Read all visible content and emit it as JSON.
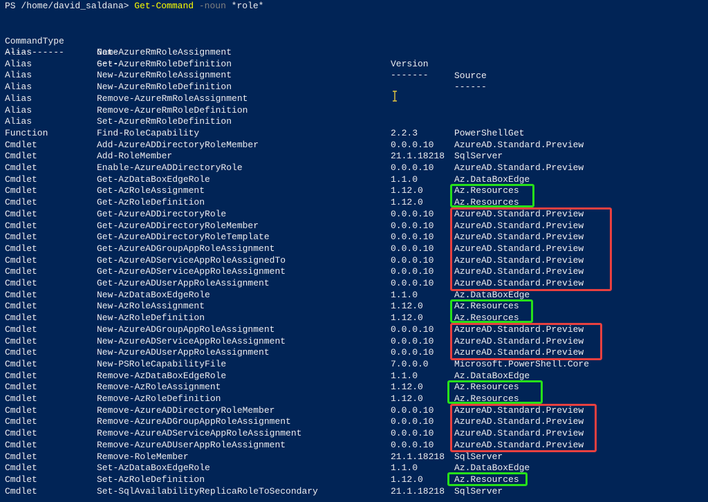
{
  "prompt": {
    "path": "PS /home/david_saldana> ",
    "command": "Get-Command",
    "param": " -noun ",
    "arg": "*role*"
  },
  "headers": {
    "type": "CommandType",
    "name": "Name",
    "version": "Version",
    "source": "Source",
    "type_rule": "-----------",
    "name_rule": "----",
    "version_rule": "-------",
    "source_rule": "------"
  },
  "rows": [
    {
      "type": "Alias",
      "name": "Get-AzureRmRoleAssignment",
      "version": "",
      "source": ""
    },
    {
      "type": "Alias",
      "name": "Get-AzureRmRoleDefinition",
      "version": "",
      "source": ""
    },
    {
      "type": "Alias",
      "name": "New-AzureRmRoleAssignment",
      "version": "",
      "source": ""
    },
    {
      "type": "Alias",
      "name": "New-AzureRmRoleDefinition",
      "version": "",
      "source": ""
    },
    {
      "type": "Alias",
      "name": "Remove-AzureRmRoleAssignment",
      "version": "",
      "source": ""
    },
    {
      "type": "Alias",
      "name": "Remove-AzureRmRoleDefinition",
      "version": "",
      "source": ""
    },
    {
      "type": "Alias",
      "name": "Set-AzureRmRoleDefinition",
      "version": "",
      "source": ""
    },
    {
      "type": "Function",
      "name": "Find-RoleCapability",
      "version": "2.2.3",
      "source": "PowerShellGet"
    },
    {
      "type": "Cmdlet",
      "name": "Add-AzureADDirectoryRoleMember",
      "version": "0.0.0.10",
      "source": "AzureAD.Standard.Preview"
    },
    {
      "type": "Cmdlet",
      "name": "Add-RoleMember",
      "version": "21.1.18218",
      "source": "SqlServer"
    },
    {
      "type": "Cmdlet",
      "name": "Enable-AzureADDirectoryRole",
      "version": "0.0.0.10",
      "source": "AzureAD.Standard.Preview"
    },
    {
      "type": "Cmdlet",
      "name": "Get-AzDataBoxEdgeRole",
      "version": "1.1.0",
      "source": "Az.DataBoxEdge"
    },
    {
      "type": "Cmdlet",
      "name": "Get-AzRoleAssignment",
      "version": "1.12.0",
      "source": "Az.Resources"
    },
    {
      "type": "Cmdlet",
      "name": "Get-AzRoleDefinition",
      "version": "1.12.0",
      "source": "Az.Resources"
    },
    {
      "type": "Cmdlet",
      "name": "Get-AzureADDirectoryRole",
      "version": "0.0.0.10",
      "source": "AzureAD.Standard.Preview"
    },
    {
      "type": "Cmdlet",
      "name": "Get-AzureADDirectoryRoleMember",
      "version": "0.0.0.10",
      "source": "AzureAD.Standard.Preview"
    },
    {
      "type": "Cmdlet",
      "name": "Get-AzureADDirectoryRoleTemplate",
      "version": "0.0.0.10",
      "source": "AzureAD.Standard.Preview"
    },
    {
      "type": "Cmdlet",
      "name": "Get-AzureADGroupAppRoleAssignment",
      "version": "0.0.0.10",
      "source": "AzureAD.Standard.Preview"
    },
    {
      "type": "Cmdlet",
      "name": "Get-AzureADServiceAppRoleAssignedTo",
      "version": "0.0.0.10",
      "source": "AzureAD.Standard.Preview"
    },
    {
      "type": "Cmdlet",
      "name": "Get-AzureADServiceAppRoleAssignment",
      "version": "0.0.0.10",
      "source": "AzureAD.Standard.Preview"
    },
    {
      "type": "Cmdlet",
      "name": "Get-AzureADUserAppRoleAssignment",
      "version": "0.0.0.10",
      "source": "AzureAD.Standard.Preview"
    },
    {
      "type": "Cmdlet",
      "name": "New-AzDataBoxEdgeRole",
      "version": "1.1.0",
      "source": "Az.DataBoxEdge"
    },
    {
      "type": "Cmdlet",
      "name": "New-AzRoleAssignment",
      "version": "1.12.0",
      "source": "Az.Resources"
    },
    {
      "type": "Cmdlet",
      "name": "New-AzRoleDefinition",
      "version": "1.12.0",
      "source": "Az.Resources"
    },
    {
      "type": "Cmdlet",
      "name": "New-AzureADGroupAppRoleAssignment",
      "version": "0.0.0.10",
      "source": "AzureAD.Standard.Preview"
    },
    {
      "type": "Cmdlet",
      "name": "New-AzureADServiceAppRoleAssignment",
      "version": "0.0.0.10",
      "source": "AzureAD.Standard.Preview"
    },
    {
      "type": "Cmdlet",
      "name": "New-AzureADUserAppRoleAssignment",
      "version": "0.0.0.10",
      "source": "AzureAD.Standard.Preview"
    },
    {
      "type": "Cmdlet",
      "name": "New-PSRoleCapabilityFile",
      "version": "7.0.0.0",
      "source": "Microsoft.PowerShell.Core"
    },
    {
      "type": "Cmdlet",
      "name": "Remove-AzDataBoxEdgeRole",
      "version": "1.1.0",
      "source": "Az.DataBoxEdge"
    },
    {
      "type": "Cmdlet",
      "name": "Remove-AzRoleAssignment",
      "version": "1.12.0",
      "source": "Az.Resources"
    },
    {
      "type": "Cmdlet",
      "name": "Remove-AzRoleDefinition",
      "version": "1.12.0",
      "source": "Az.Resources"
    },
    {
      "type": "Cmdlet",
      "name": "Remove-AzureADDirectoryRoleMember",
      "version": "0.0.0.10",
      "source": "AzureAD.Standard.Preview"
    },
    {
      "type": "Cmdlet",
      "name": "Remove-AzureADGroupAppRoleAssignment",
      "version": "0.0.0.10",
      "source": "AzureAD.Standard.Preview"
    },
    {
      "type": "Cmdlet",
      "name": "Remove-AzureADServiceAppRoleAssignment",
      "version": "0.0.0.10",
      "source": "AzureAD.Standard.Preview"
    },
    {
      "type": "Cmdlet",
      "name": "Remove-AzureADUserAppRoleAssignment",
      "version": "0.0.0.10",
      "source": "AzureAD.Standard.Preview"
    },
    {
      "type": "Cmdlet",
      "name": "Remove-RoleMember",
      "version": "21.1.18218",
      "source": "SqlServer"
    },
    {
      "type": "Cmdlet",
      "name": "Set-AzDataBoxEdgeRole",
      "version": "1.1.0",
      "source": "Az.DataBoxEdge"
    },
    {
      "type": "Cmdlet",
      "name": "Set-AzRoleDefinition",
      "version": "1.12.0",
      "source": "Az.Resources"
    },
    {
      "type": "Cmdlet",
      "name": "Set-SqlAvailabilityReplicaRoleToSecondary",
      "version": "21.1.18218",
      "source": "SqlServer"
    }
  ],
  "colors": {
    "background": "#012456",
    "text": "#eeedf0",
    "command": "#ffff00",
    "param": "#808080",
    "highlight_green": "#26e01a",
    "highlight_red": "#e84040"
  },
  "icons": {
    "text_cursor": "i-beam-cursor-icon"
  }
}
